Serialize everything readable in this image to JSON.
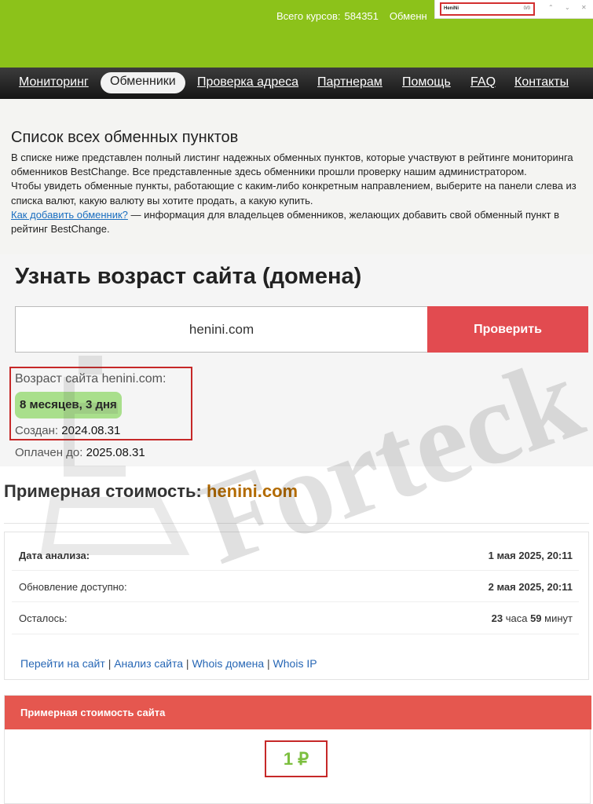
{
  "header": {
    "courses_label": "Всего курсов:",
    "courses_count": "584351",
    "exchangers_partial": "Обменн"
  },
  "find_bar": {
    "query": "HeniNi",
    "count": "0/0",
    "up_glyph": "⌃",
    "down_glyph": "⌄",
    "close_glyph": "✕"
  },
  "nav": {
    "items": [
      "Мониторинг",
      "Обменники",
      "Проверка адреса",
      "Партнерам",
      "Помощь",
      "FAQ",
      "Контакты"
    ],
    "active_index": 1
  },
  "intro": {
    "title": "Список всех обменных пунктов",
    "p1": "В списке ниже представлен полный листинг надежных обменных пунктов, которые участвуют в рейтинге мониторинга обменников BestChange. Все представленные здесь обменники прошли проверку нашим администратором.",
    "p2": "Чтобы увидеть обменные пункты, работающие с каким-либо конкретным направлением, выберите на панели слева из списка валют, какую валюту вы хотите продать, а какую купить.",
    "link": "Как добавить обменник?",
    "p3": " — информация для владельцев обменников, желающих добавить свой обменный пункт в рейтинг BestChange."
  },
  "age_check": {
    "title": "Узнать возраст сайта (домена)",
    "input_value": "henini.com",
    "button": "Проверить",
    "age_label": "Возраст сайта henini.com:",
    "age_value": "8 месяцев, 3 дня",
    "created_label": "Создан:",
    "created_value": "2024.08.31",
    "paid_label": "Оплачен до:",
    "paid_value": "2025.08.31"
  },
  "cost": {
    "title": "Примерная стоимость:",
    "domain": "henini.com",
    "rows": [
      {
        "label": "Дата анализа:",
        "value": "1 мая 2025, 20:11"
      },
      {
        "label": "Обновление доступно:",
        "value": "2 мая 2025, 20:11"
      },
      {
        "label": "Осталось:",
        "hours": "23",
        "hours_unit": "часа",
        "minutes": "59",
        "minutes_unit": "минут"
      }
    ],
    "links": [
      "Перейти на сайт",
      "Анализ сайта",
      "Whois домена",
      "Whois IP"
    ],
    "separator": "|",
    "value_header": "Примерная стоимость сайта",
    "value": "1 ₽"
  },
  "watermark_text": "Forteck",
  "colors": {
    "header_green": "#8cc21a",
    "check_button": "#e24b50",
    "value_header": "#e5574f",
    "highlight_border": "#c62828",
    "age_badge": "#a9df8c",
    "domain_accent": "#b36b00",
    "link_blue": "#2767b5"
  }
}
